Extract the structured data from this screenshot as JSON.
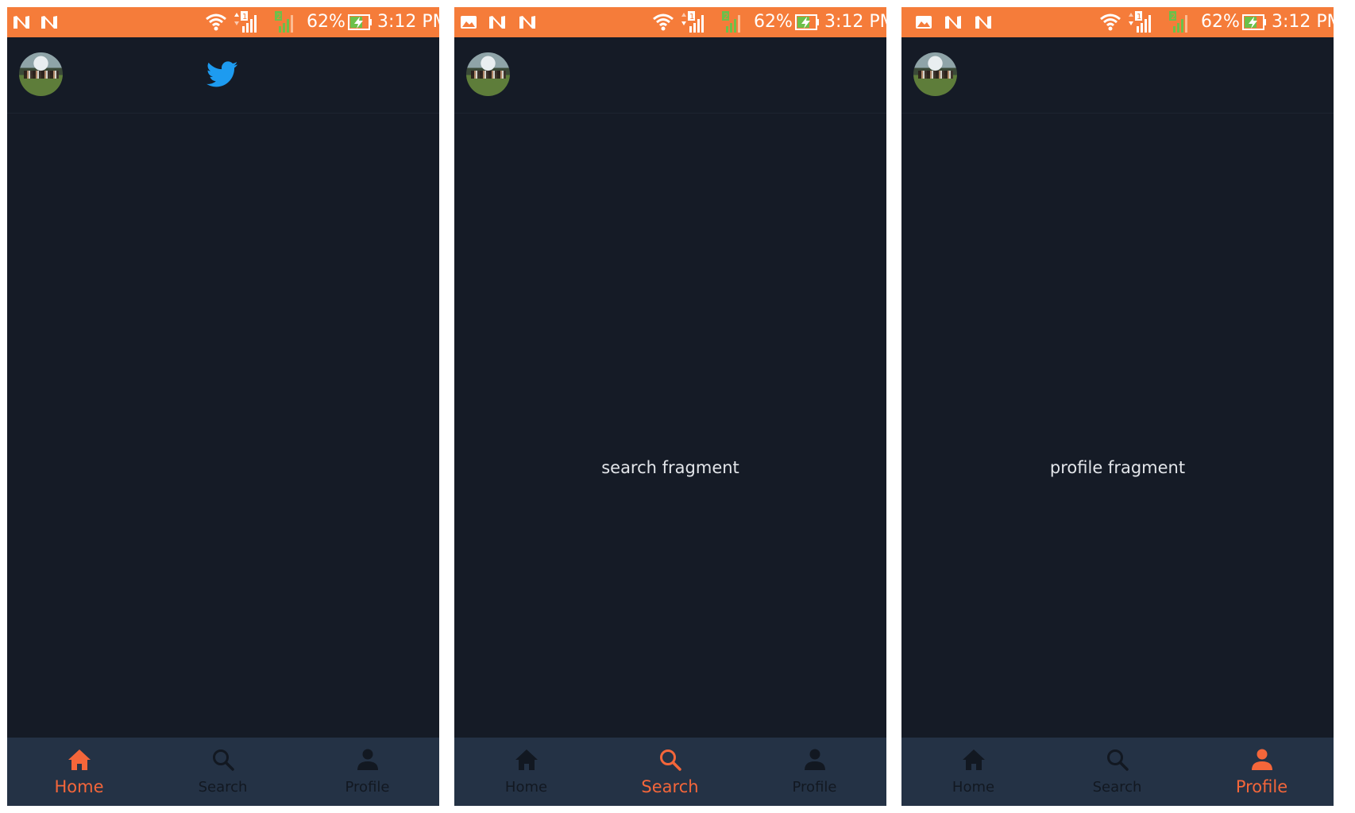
{
  "status_bar": {
    "battery": "62%",
    "time": "3:12 PM"
  },
  "nav": {
    "home": "Home",
    "search": "Search",
    "profile": "Profile"
  },
  "screens": [
    {
      "fragment_text": "",
      "active_tab": "home"
    },
    {
      "fragment_text": "search fragment",
      "active_tab": "search"
    },
    {
      "fragment_text": "profile fragment",
      "active_tab": "profile"
    }
  ],
  "colors": {
    "status_bar": "#f57c3a",
    "background": "#151b26",
    "bottom_nav": "#243245",
    "accent_active": "#f4663a",
    "inactive_nav": "#121821",
    "twitter_blue": "#1d9bf0"
  },
  "icons": [
    "n-notification-icon",
    "image-notification-icon",
    "wifi-icon",
    "signal-icon",
    "battery-charging-icon",
    "twitter-bird-icon",
    "home-icon",
    "search-icon",
    "profile-icon"
  ]
}
